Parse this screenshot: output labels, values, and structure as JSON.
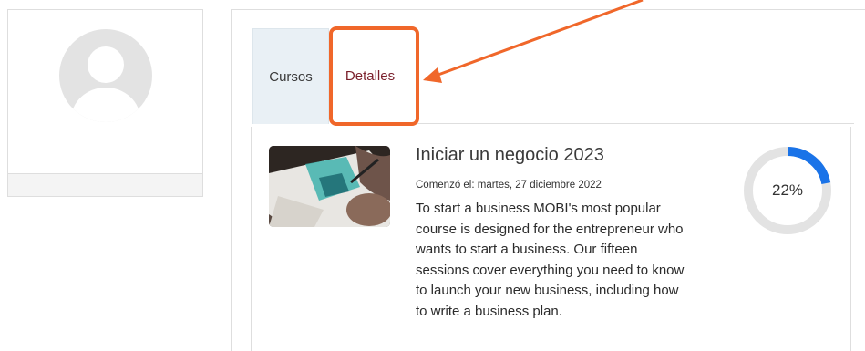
{
  "tabs": [
    {
      "label": "Cursos"
    },
    {
      "label": "Detalles"
    }
  ],
  "course": {
    "title": "Iniciar un negocio 2023",
    "started": "Comenzó el: martes, 27 diciembre 2022",
    "description": "To start a business MOBI's most popular course is designed for the entrepreneur who wants to start a business. Our fifteen sessions cover everything you need to know to launch your new business, including how to write a business plan.",
    "progress_percent": 22,
    "progress_label": "22%"
  },
  "colors": {
    "annotation": "#f0672a",
    "active_tab": "#7a1f2b",
    "progress": "#1a73e8",
    "progress_track": "#e3e3e3"
  },
  "icons": {
    "avatar": "default-user-avatar-icon"
  }
}
